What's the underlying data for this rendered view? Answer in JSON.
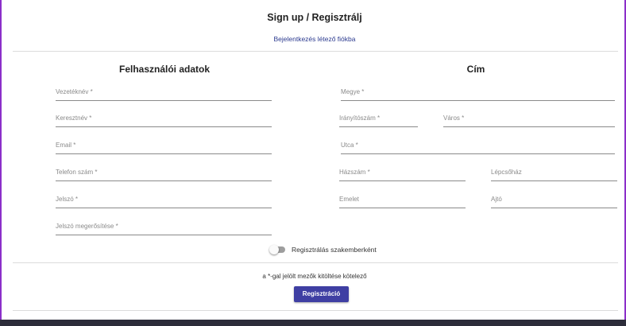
{
  "header": {
    "title": "Sign up / Regisztrálj",
    "login_link": "Bejelentkezés létező fiókba"
  },
  "personal": {
    "title": "Felhasználói adatok",
    "last_name": "Vezetéknév *",
    "first_name": "Keresztnév *",
    "email": "Email *",
    "phone": "Telefon szám *",
    "password": "Jelszó *",
    "password_confirm": "Jelszó megerősítése *"
  },
  "address": {
    "title": "Cím",
    "county": "Megye *",
    "zip": "Irányítószám *",
    "city": "Város *",
    "street": "Utca *",
    "house_number": "Házszám *",
    "staircase": "Lépcsőház",
    "floor": "Emelet",
    "door": "Ajtó"
  },
  "expert_toggle": {
    "label": "Regisztrálás szakemberként",
    "checked": false
  },
  "footer": {
    "required_note": "a *-gal jelölt mezők kitöltése kötelező",
    "submit_label": "Regisztráció"
  },
  "colors": {
    "accent": "#3f3fa3",
    "link": "#2b3a8f",
    "frame": "#8b2fc9"
  }
}
